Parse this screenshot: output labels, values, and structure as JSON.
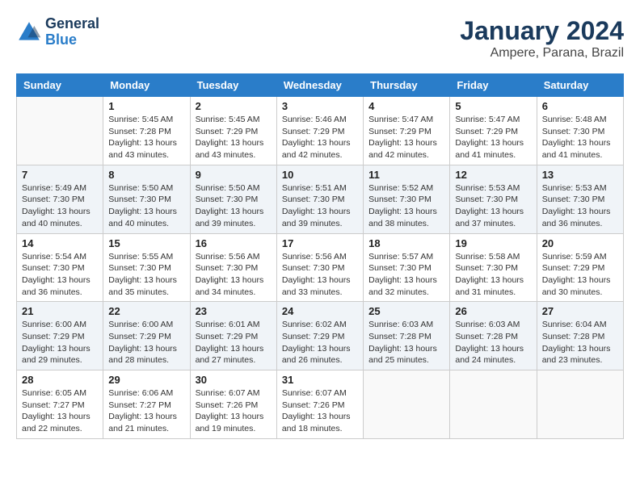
{
  "header": {
    "logo_line1": "General",
    "logo_line2": "Blue",
    "main_title": "January 2024",
    "sub_title": "Ampere, Parana, Brazil"
  },
  "weekdays": [
    "Sunday",
    "Monday",
    "Tuesday",
    "Wednesday",
    "Thursday",
    "Friday",
    "Saturday"
  ],
  "weeks": [
    [
      {
        "day": "",
        "info": ""
      },
      {
        "day": "1",
        "info": "Sunrise: 5:45 AM\nSunset: 7:28 PM\nDaylight: 13 hours\nand 43 minutes."
      },
      {
        "day": "2",
        "info": "Sunrise: 5:45 AM\nSunset: 7:29 PM\nDaylight: 13 hours\nand 43 minutes."
      },
      {
        "day": "3",
        "info": "Sunrise: 5:46 AM\nSunset: 7:29 PM\nDaylight: 13 hours\nand 42 minutes."
      },
      {
        "day": "4",
        "info": "Sunrise: 5:47 AM\nSunset: 7:29 PM\nDaylight: 13 hours\nand 42 minutes."
      },
      {
        "day": "5",
        "info": "Sunrise: 5:47 AM\nSunset: 7:29 PM\nDaylight: 13 hours\nand 41 minutes."
      },
      {
        "day": "6",
        "info": "Sunrise: 5:48 AM\nSunset: 7:30 PM\nDaylight: 13 hours\nand 41 minutes."
      }
    ],
    [
      {
        "day": "7",
        "info": "Sunrise: 5:49 AM\nSunset: 7:30 PM\nDaylight: 13 hours\nand 40 minutes."
      },
      {
        "day": "8",
        "info": "Sunrise: 5:50 AM\nSunset: 7:30 PM\nDaylight: 13 hours\nand 40 minutes."
      },
      {
        "day": "9",
        "info": "Sunrise: 5:50 AM\nSunset: 7:30 PM\nDaylight: 13 hours\nand 39 minutes."
      },
      {
        "day": "10",
        "info": "Sunrise: 5:51 AM\nSunset: 7:30 PM\nDaylight: 13 hours\nand 39 minutes."
      },
      {
        "day": "11",
        "info": "Sunrise: 5:52 AM\nSunset: 7:30 PM\nDaylight: 13 hours\nand 38 minutes."
      },
      {
        "day": "12",
        "info": "Sunrise: 5:53 AM\nSunset: 7:30 PM\nDaylight: 13 hours\nand 37 minutes."
      },
      {
        "day": "13",
        "info": "Sunrise: 5:53 AM\nSunset: 7:30 PM\nDaylight: 13 hours\nand 36 minutes."
      }
    ],
    [
      {
        "day": "14",
        "info": "Sunrise: 5:54 AM\nSunset: 7:30 PM\nDaylight: 13 hours\nand 36 minutes."
      },
      {
        "day": "15",
        "info": "Sunrise: 5:55 AM\nSunset: 7:30 PM\nDaylight: 13 hours\nand 35 minutes."
      },
      {
        "day": "16",
        "info": "Sunrise: 5:56 AM\nSunset: 7:30 PM\nDaylight: 13 hours\nand 34 minutes."
      },
      {
        "day": "17",
        "info": "Sunrise: 5:56 AM\nSunset: 7:30 PM\nDaylight: 13 hours\nand 33 minutes."
      },
      {
        "day": "18",
        "info": "Sunrise: 5:57 AM\nSunset: 7:30 PM\nDaylight: 13 hours\nand 32 minutes."
      },
      {
        "day": "19",
        "info": "Sunrise: 5:58 AM\nSunset: 7:30 PM\nDaylight: 13 hours\nand 31 minutes."
      },
      {
        "day": "20",
        "info": "Sunrise: 5:59 AM\nSunset: 7:29 PM\nDaylight: 13 hours\nand 30 minutes."
      }
    ],
    [
      {
        "day": "21",
        "info": "Sunrise: 6:00 AM\nSunset: 7:29 PM\nDaylight: 13 hours\nand 29 minutes."
      },
      {
        "day": "22",
        "info": "Sunrise: 6:00 AM\nSunset: 7:29 PM\nDaylight: 13 hours\nand 28 minutes."
      },
      {
        "day": "23",
        "info": "Sunrise: 6:01 AM\nSunset: 7:29 PM\nDaylight: 13 hours\nand 27 minutes."
      },
      {
        "day": "24",
        "info": "Sunrise: 6:02 AM\nSunset: 7:29 PM\nDaylight: 13 hours\nand 26 minutes."
      },
      {
        "day": "25",
        "info": "Sunrise: 6:03 AM\nSunset: 7:28 PM\nDaylight: 13 hours\nand 25 minutes."
      },
      {
        "day": "26",
        "info": "Sunrise: 6:03 AM\nSunset: 7:28 PM\nDaylight: 13 hours\nand 24 minutes."
      },
      {
        "day": "27",
        "info": "Sunrise: 6:04 AM\nSunset: 7:28 PM\nDaylight: 13 hours\nand 23 minutes."
      }
    ],
    [
      {
        "day": "28",
        "info": "Sunrise: 6:05 AM\nSunset: 7:27 PM\nDaylight: 13 hours\nand 22 minutes."
      },
      {
        "day": "29",
        "info": "Sunrise: 6:06 AM\nSunset: 7:27 PM\nDaylight: 13 hours\nand 21 minutes."
      },
      {
        "day": "30",
        "info": "Sunrise: 6:07 AM\nSunset: 7:26 PM\nDaylight: 13 hours\nand 19 minutes."
      },
      {
        "day": "31",
        "info": "Sunrise: 6:07 AM\nSunset: 7:26 PM\nDaylight: 13 hours\nand 18 minutes."
      },
      {
        "day": "",
        "info": ""
      },
      {
        "day": "",
        "info": ""
      },
      {
        "day": "",
        "info": ""
      }
    ]
  ]
}
